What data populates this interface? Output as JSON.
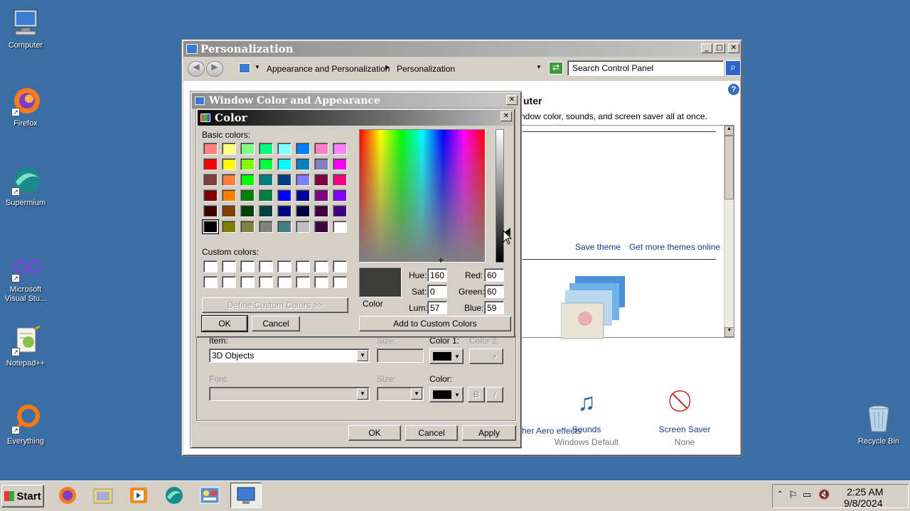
{
  "desktop": {
    "icons": [
      {
        "label": "Computer",
        "name": "computer"
      },
      {
        "label": "Firefox",
        "name": "firefox"
      },
      {
        "label": "Supermium",
        "name": "supermium"
      },
      {
        "label": "Microsoft Visual Stu...",
        "name": "visual-studio"
      },
      {
        "label": "Notepad++",
        "name": "notepad-plus-plus"
      },
      {
        "label": "Everything",
        "name": "everything"
      },
      {
        "label": "Recycle Bin",
        "name": "recycle-bin"
      }
    ]
  },
  "personalization": {
    "title": "Personalization",
    "breadcrumb": [
      "Appearance and Personalization",
      "Personalization"
    ],
    "search_placeholder": "Search Control Panel",
    "heading_partial": "uter",
    "desc_partial": "ndow color, sounds, and screen saver all at once.",
    "save_theme": "Save theme",
    "get_more_themes": "Get more themes online",
    "sounds": {
      "label": "Sounds",
      "value": "Windows Default"
    },
    "screensaver": {
      "label": "Screen Saver",
      "value": "None"
    },
    "aero_partial": "her Aero effects"
  },
  "wca": {
    "title": "Window Color and Appearance",
    "item_label": "Item:",
    "item_value": "3D Objects",
    "size_label": "Size:",
    "color1_label": "Color 1:",
    "color2_label": "Color 2:",
    "font_label": "Font:",
    "size2_label": "Size:",
    "color_label": "Color:",
    "bold": "B",
    "italic": "I",
    "ok": "OK",
    "cancel": "Cancel",
    "apply": "Apply"
  },
  "color_dialog": {
    "title": "Color",
    "basic_colors_label": "Basic colors:",
    "custom_colors_label": "Custom colors:",
    "define_custom": "Define Custom Colors >>",
    "ok": "OK",
    "cancel": "Cancel",
    "add_custom": "Add to Custom Colors",
    "color_solid_label": "Color",
    "hue_label": "Hue:",
    "hue": "160",
    "sat_label": "Sat:",
    "sat": "0",
    "lum_label": "Lum:",
    "lum": "57",
    "red_label": "Red:",
    "red": "60",
    "green_label": "Green:",
    "green": "60",
    "blue_label": "Blue:",
    "blue": "59",
    "selected_color": "#3c3c3b",
    "basic_colors": [
      "#ff8080",
      "#ffff80",
      "#80ff80",
      "#00ff80",
      "#80ffff",
      "#0080ff",
      "#ff80c0",
      "#ff80ff",
      "#ff0000",
      "#ffff00",
      "#80ff00",
      "#00ff40",
      "#00ffff",
      "#0080c0",
      "#8080c0",
      "#ff00ff",
      "#804040",
      "#ff8040",
      "#00ff00",
      "#008080",
      "#004080",
      "#8080ff",
      "#800040",
      "#ff0080",
      "#800000",
      "#ff8000",
      "#008000",
      "#008040",
      "#0000ff",
      "#0000a0",
      "#800080",
      "#8000ff",
      "#400000",
      "#804000",
      "#004000",
      "#004040",
      "#000080",
      "#000040",
      "#400040",
      "#400080",
      "#000000",
      "#808000",
      "#808040",
      "#808080",
      "#408080",
      "#c0c0c0",
      "#400040",
      "#ffffff"
    ]
  },
  "taskbar": {
    "start": "Start",
    "time": "2:25 AM",
    "date": "9/8/2024"
  }
}
